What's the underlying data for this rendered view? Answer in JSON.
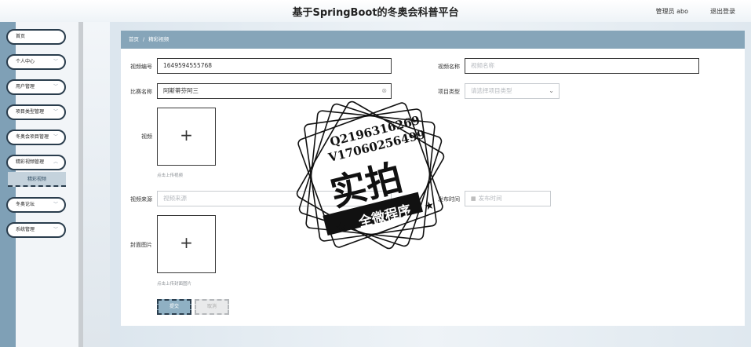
{
  "header": {
    "title": "基于SpringBoot的冬奥会科普平台",
    "admin_label": "管理员 abo",
    "logout_label": "退出登录"
  },
  "sidebar": {
    "items": [
      {
        "label": "首页",
        "has_chevron": false
      },
      {
        "label": "个人中心",
        "has_chevron": true
      },
      {
        "label": "用户管理",
        "has_chevron": true
      },
      {
        "label": "项目类型管理",
        "has_chevron": true
      },
      {
        "label": "冬奥会项目管理",
        "has_chevron": true
      },
      {
        "label": "精彩视频管理",
        "has_chevron": true
      },
      {
        "label": "冬奥论坛",
        "has_chevron": true
      },
      {
        "label": "系统管理",
        "has_chevron": true
      }
    ],
    "submenu": {
      "label": "精彩视频"
    }
  },
  "breadcrumb": {
    "home": "首页",
    "separator": "/",
    "current": "精彩视频"
  },
  "form": {
    "video_no": {
      "label": "视频编号",
      "value": "1649594555768"
    },
    "video_name": {
      "label": "视频名称",
      "placeholder": "视频名称"
    },
    "event_name": {
      "label": "比赛名称",
      "value": "阿斯蒂芬阿三"
    },
    "project_type": {
      "label": "项目类型",
      "placeholder": "请选择项目类型"
    },
    "video": {
      "label": "视频",
      "hint": "点击上传视频"
    },
    "video_source": {
      "label": "视频来源",
      "placeholder": "视频来源"
    },
    "publish_time": {
      "label": "发布时间",
      "placeholder": "发布时间"
    },
    "cover_image": {
      "label": "封面图片",
      "hint": "点击上传封面图片"
    },
    "upload_plus": "+",
    "submit_label": "提交",
    "cancel_label": "取消"
  },
  "watermark": {
    "qq": "Q2196316269",
    "vx": "V17060256499",
    "big_text": "实拍",
    "banner_text": "全微程序"
  },
  "colors": {
    "accent": "#86a5b9",
    "sidebar_stripe": "#7fa0b6",
    "menu_border": "#2a3d4d"
  }
}
